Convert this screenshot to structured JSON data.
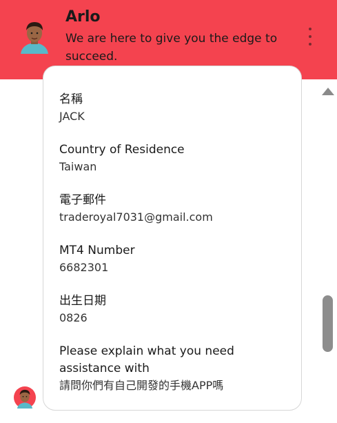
{
  "header": {
    "agent_name": "Arlo",
    "tagline": "We are here to give you the edge to succeed.",
    "accent_color": "#f4434f",
    "menu_icon": "more-vertical-icon"
  },
  "message": {
    "fields": [
      {
        "label": "名稱",
        "value": "JACK"
      },
      {
        "label": "Country of Residence",
        "value": "Taiwan"
      },
      {
        "label": "電子郵件",
        "value": "traderoyal7031@gmail.com"
      },
      {
        "label": "MT4 Number",
        "value": "6682301"
      },
      {
        "label": "出生日期",
        "value": "0826"
      },
      {
        "label": "Please explain what you need assistance with",
        "value": "請問你們有自己開發的手機APP嗎"
      }
    ]
  },
  "icons": {
    "agent_avatar": "agent-avatar-icon",
    "scroll_up": "scroll-up-arrow-icon"
  }
}
